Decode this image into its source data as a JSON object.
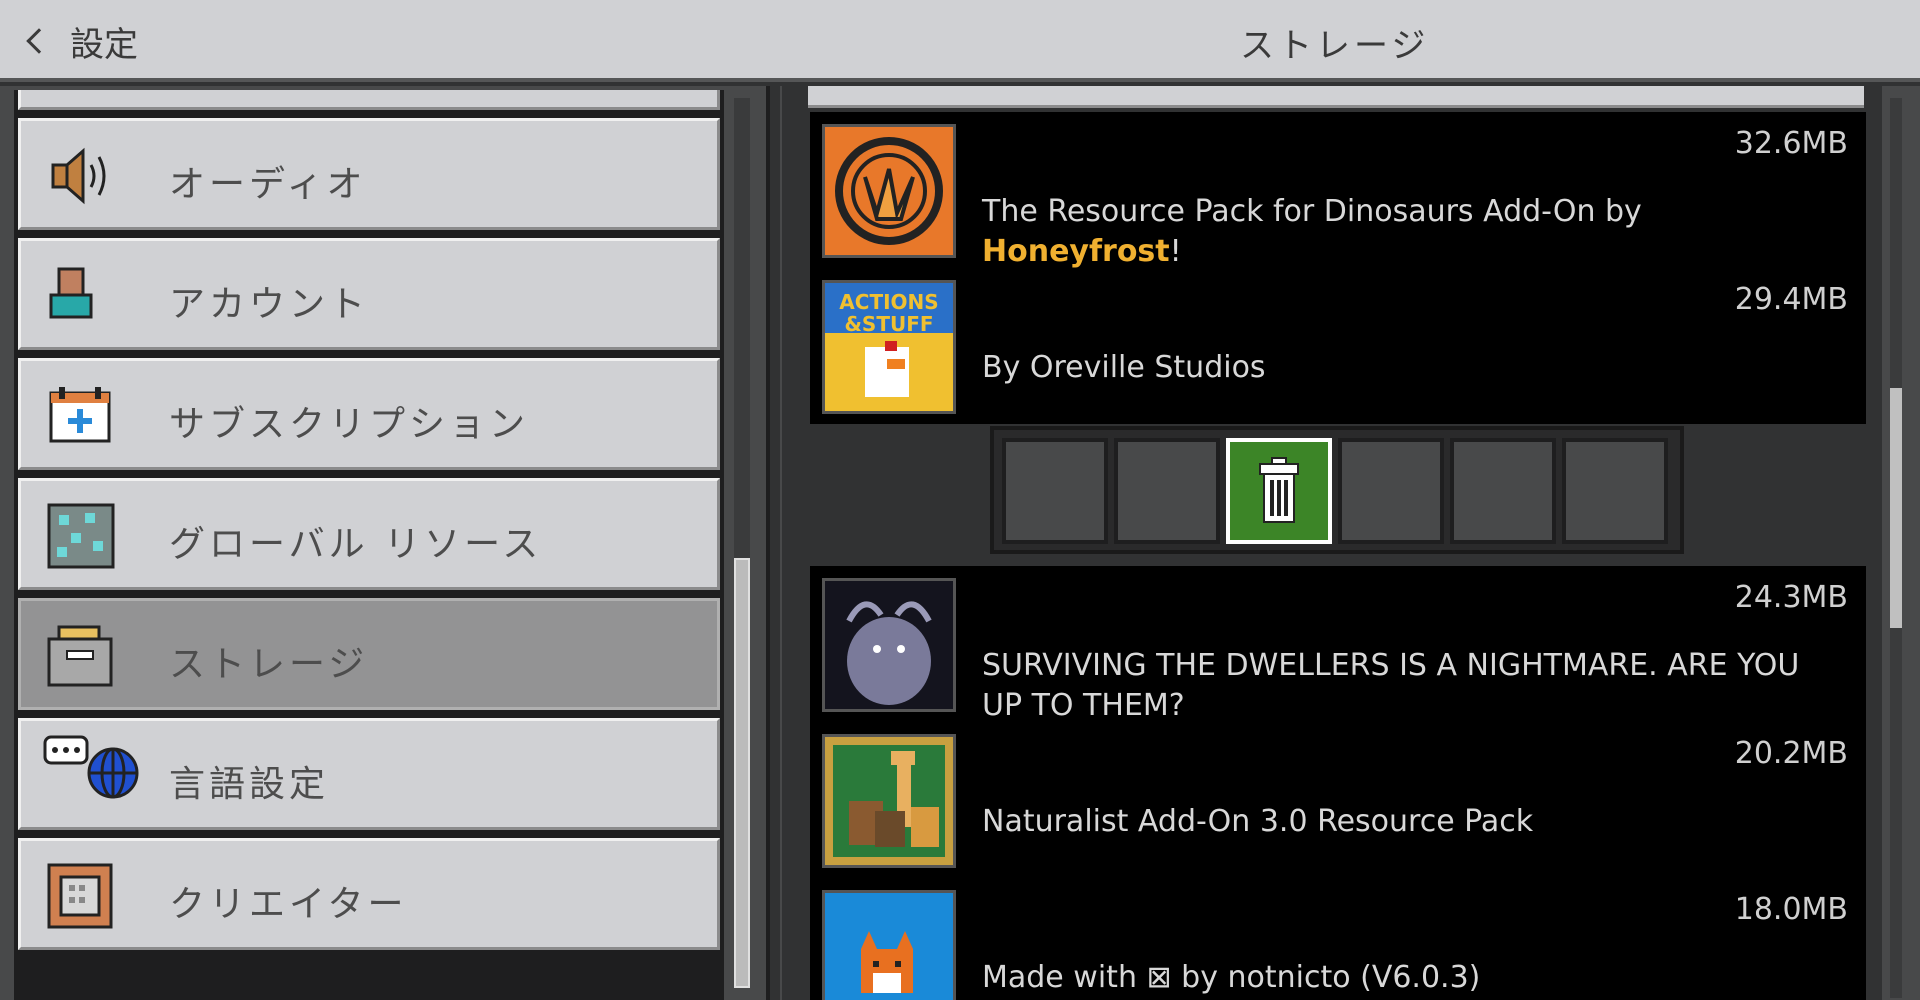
{
  "header": {
    "back_label": "設定",
    "title": "ストレージ"
  },
  "sidebar": {
    "items": [
      {
        "label": "オーディオ",
        "icon": "speaker-icon"
      },
      {
        "label": "アカウント",
        "icon": "account-icon"
      },
      {
        "label": "サブスクリプション",
        "icon": "calendar-plus-icon"
      },
      {
        "label": "グローバル リソース",
        "icon": "diamond-ore-icon"
      },
      {
        "label": "ストレージ",
        "icon": "storage-drawer-icon",
        "active": true
      },
      {
        "label": "言語設定",
        "icon": "language-globe-icon"
      },
      {
        "label": "クリエイター",
        "icon": "command-block-icon"
      }
    ]
  },
  "storage_list": {
    "items": [
      {
        "size": "32.6MB",
        "desc_prefix": "The Resource Pack for Dinosaurs Add-On by ",
        "desc_highlight": "Honeyfrost",
        "desc_suffix": "!",
        "icon": "dinosaur-claw-icon"
      },
      {
        "size": "29.4MB",
        "desc": "By Oreville Studios",
        "icon": "actions-and-stuff-icon",
        "icon_text_1": "ACTIONS",
        "icon_text_2": "&STUFF"
      },
      {
        "size": "24.3MB",
        "desc": "SURVIVING THE DWELLERS IS A NIGHTMARE. ARE YOU UP TO THEM?",
        "icon": "dweller-monster-icon"
      },
      {
        "size": "20.2MB",
        "desc": "Naturalist Add-On 3.0 Resource Pack",
        "icon": "naturalist-animals-icon"
      },
      {
        "size": "18.0MB",
        "desc": "Made with ⊠ by notnicto (V6.0.3)",
        "icon": "fox-icon"
      }
    ]
  },
  "action_bar": {
    "selected_icon": "trash-icon",
    "slot_count": 6,
    "selected_index": 2
  },
  "colors": {
    "accent_green": "#3c8527",
    "highlight_gold": "#f0b030"
  }
}
